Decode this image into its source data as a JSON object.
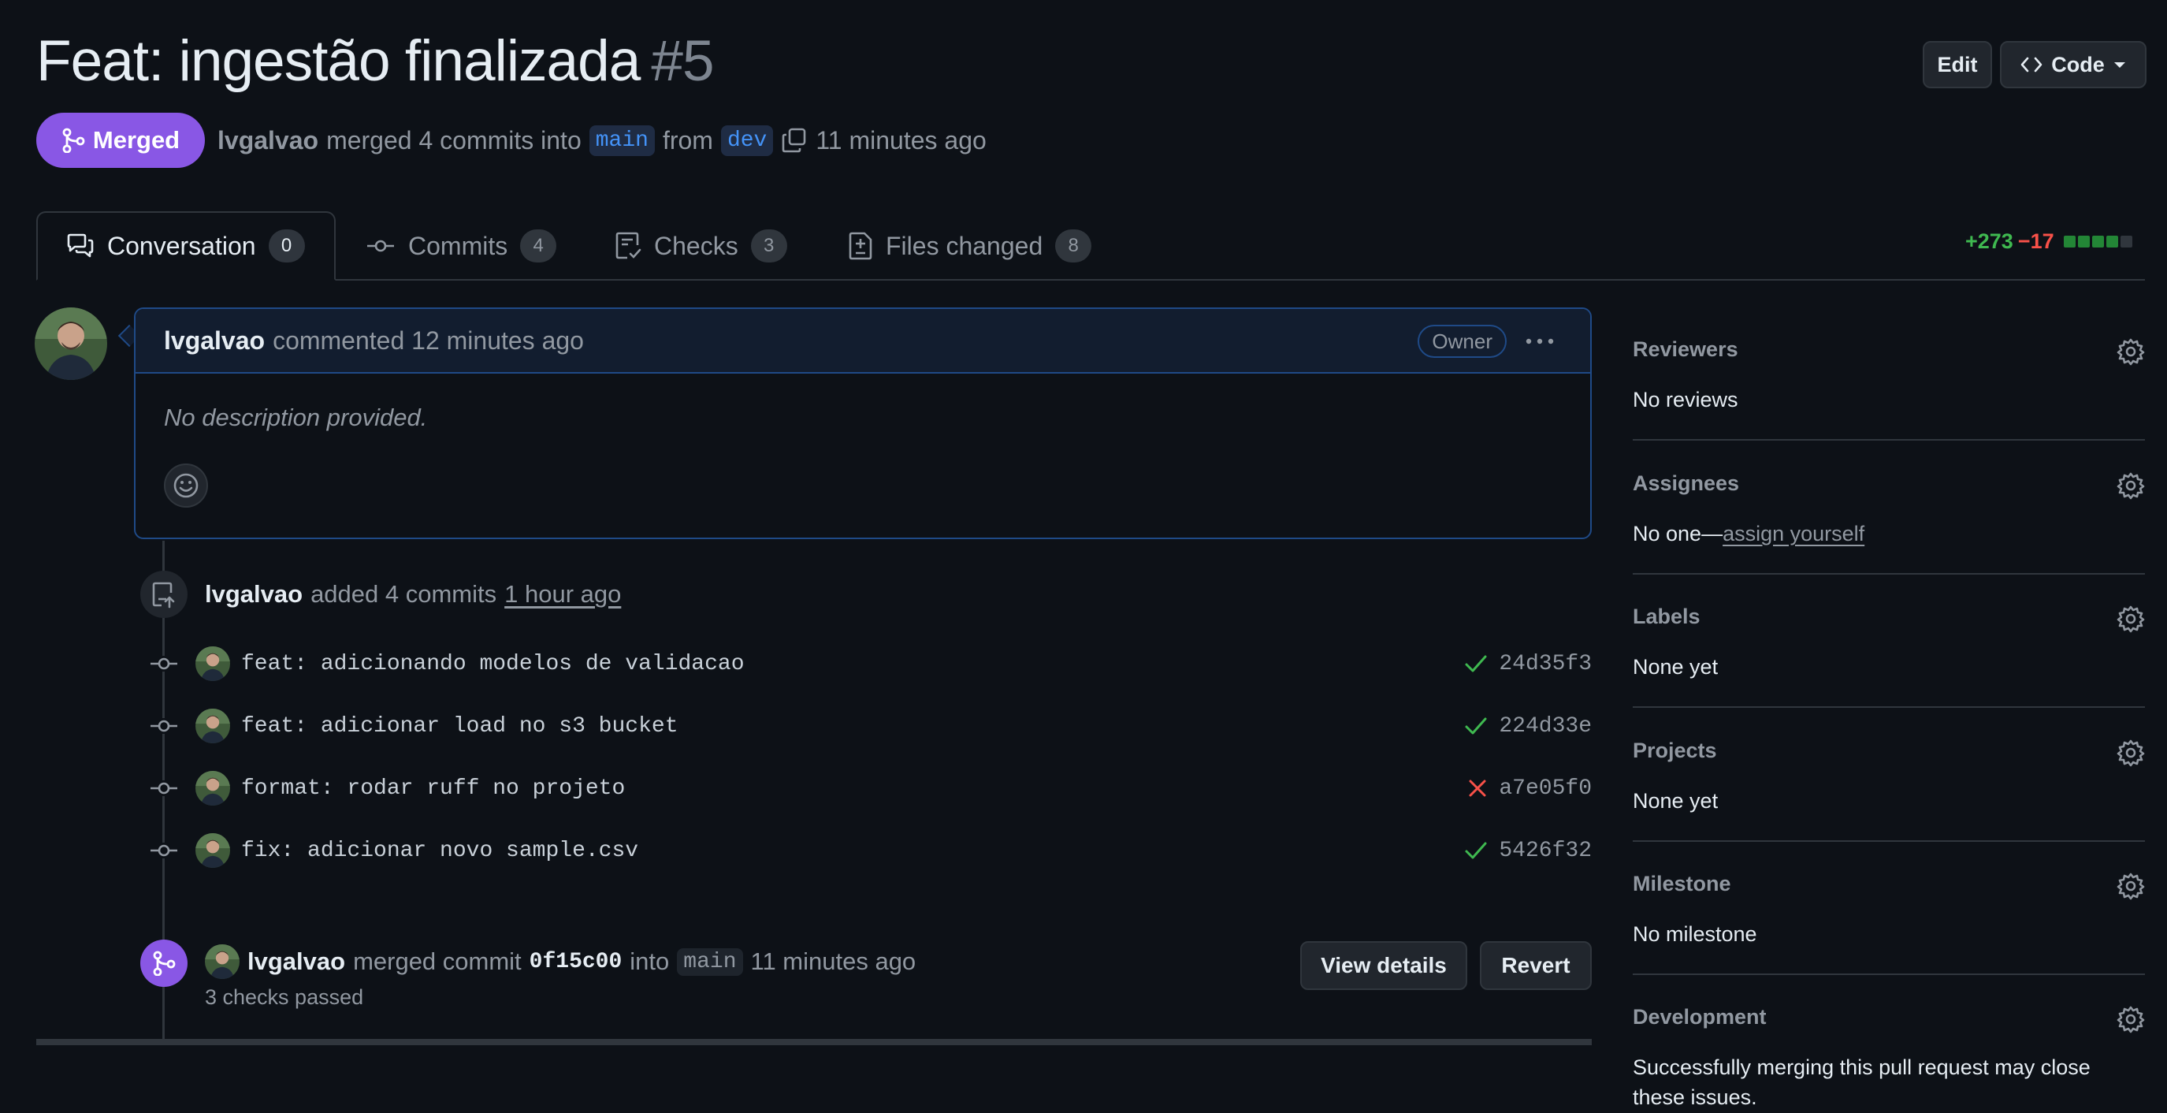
{
  "header": {
    "title": "Feat: ingestão finalizada",
    "number": "#5",
    "edit_label": "Edit",
    "code_label": "Code"
  },
  "status": {
    "badge_label": "Merged",
    "author": "lvgalvao",
    "action": "merged 4 commits into",
    "base_branch": "main",
    "from_text": "from",
    "head_branch": "dev",
    "time": "11 minutes ago"
  },
  "tabs": [
    {
      "label": "Conversation",
      "count": "0"
    },
    {
      "label": "Commits",
      "count": "4"
    },
    {
      "label": "Checks",
      "count": "3"
    },
    {
      "label": "Files changed",
      "count": "8"
    }
  ],
  "diffstat": {
    "additions": "+273",
    "deletions": "−17",
    "blocks_green": 4,
    "blocks_total": 5
  },
  "comment": {
    "author": "lvgalvao",
    "meta": "commented 12 minutes ago",
    "role_badge": "Owner",
    "body": "No description provided."
  },
  "timeline": {
    "commits_event": {
      "author": "lvgalvao",
      "text": "added 4 commits",
      "time": "1 hour ago"
    },
    "commits": [
      {
        "message": "feat: adicionando modelos de validacao",
        "sha": "24d35f3",
        "status": "success"
      },
      {
        "message": "feat: adicionar load no s3 bucket",
        "sha": "224d33e",
        "status": "success"
      },
      {
        "message": "format: rodar ruff no projeto",
        "sha": "a7e05f0",
        "status": "failure"
      },
      {
        "message": "fix: adicionar novo sample.csv",
        "sha": "5426f32",
        "status": "success"
      }
    ],
    "merge_event": {
      "author": "lvgalvao",
      "text": "merged commit",
      "sha": "0f15c00",
      "into_text": "into",
      "branch": "main",
      "time": "11 minutes ago",
      "checks": "3 checks passed",
      "view_details_label": "View details",
      "revert_label": "Revert"
    }
  },
  "sidebar": {
    "reviewers": {
      "title": "Reviewers",
      "value": "No reviews"
    },
    "assignees": {
      "title": "Assignees",
      "value": "No one—",
      "link": "assign yourself"
    },
    "labels": {
      "title": "Labels",
      "value": "None yet"
    },
    "projects": {
      "title": "Projects",
      "value": "None yet"
    },
    "milestone": {
      "title": "Milestone",
      "value": "No milestone"
    },
    "development": {
      "title": "Development",
      "value": "Successfully merging this pull request may close these issues."
    }
  },
  "colors": {
    "merged": "#8957e5",
    "success": "#3fb950",
    "failure": "#f85149",
    "link": "#4493f8"
  }
}
